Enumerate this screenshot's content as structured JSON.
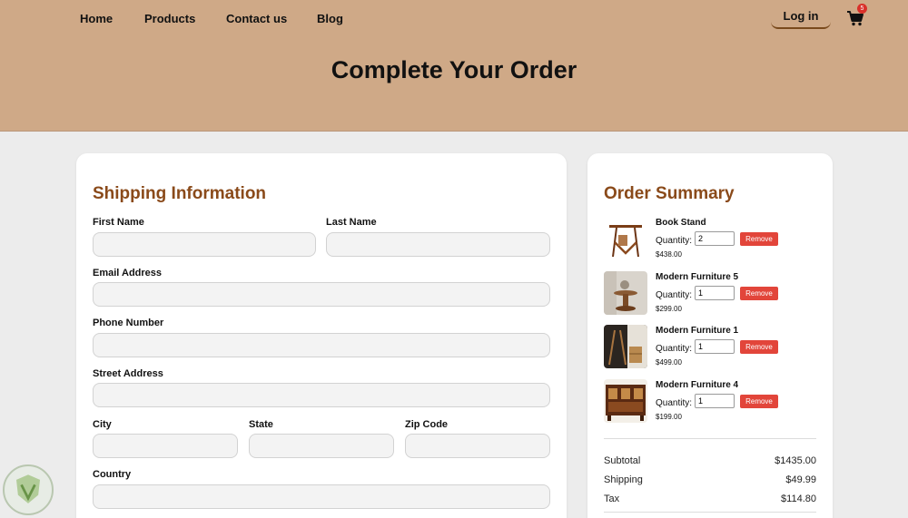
{
  "nav": {
    "links": [
      "Home",
      "Products",
      "Contact us",
      "Blog"
    ],
    "login": "Log in",
    "cart_count": "5"
  },
  "page": {
    "title": "Complete Your Order"
  },
  "shipping": {
    "title": "Shipping Information",
    "first_name": "First Name",
    "last_name": "Last Name",
    "email": "Email Address",
    "phone": "Phone Number",
    "street": "Street Address",
    "city": "City",
    "state": "State",
    "zip": "Zip Code",
    "country": "Country"
  },
  "summary": {
    "title": "Order Summary",
    "quantity_label": "Quantity:",
    "remove_label": "Remove",
    "items": [
      {
        "name": "Book Stand",
        "qty": "2",
        "price": "$438.00"
      },
      {
        "name": "Modern Furniture 5",
        "qty": "1",
        "price": "$299.00"
      },
      {
        "name": "Modern Furniture 1",
        "qty": "1",
        "price": "$499.00"
      },
      {
        "name": "Modern Furniture 4",
        "qty": "1",
        "price": "$199.00"
      }
    ],
    "subtotal_label": "Subtotal",
    "subtotal": "$1435.00",
    "shipping_label": "Shipping",
    "shipping": "$49.99",
    "tax_label": "Tax",
    "tax": "$114.80"
  },
  "colors": {
    "header": "#cfa987",
    "accent": "#8a4a1a",
    "remove": "#e2453a",
    "badge": "#d9302a"
  },
  "icons": {
    "cart": "cart-icon"
  }
}
